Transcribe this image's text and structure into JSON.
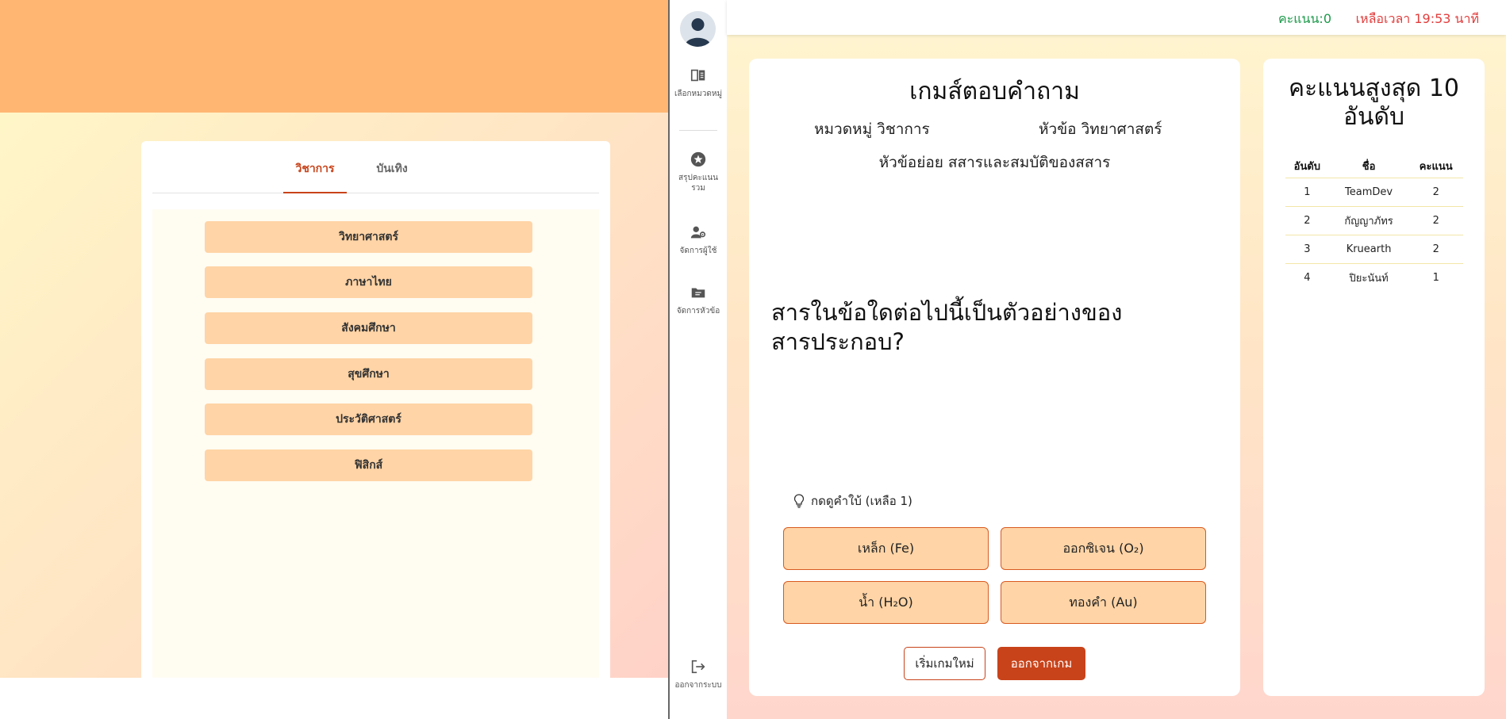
{
  "left": {
    "tabs": [
      {
        "label": "วิชาการ",
        "active": true
      },
      {
        "label": "บันเทิง",
        "active": false
      }
    ],
    "subjects": [
      "วิทยาศาสตร์",
      "ภาษาไทย",
      "สังคมศึกษา",
      "สุขศึกษา",
      "ประวัติศาสตร์",
      "ฟิสิกส์"
    ]
  },
  "sidebar": {
    "items": [
      {
        "label": "เลือกหมวดหมู่",
        "icon": "book-icon"
      },
      {
        "label": "สรุปคะแนนรวม",
        "icon": "star-icon"
      },
      {
        "label": "จัดการผู้ใช้",
        "icon": "user-gear-icon"
      },
      {
        "label": "จัดการหัวข้อ",
        "icon": "folder-icon"
      }
    ],
    "logout_label": "ออกจากระบบ"
  },
  "topbar": {
    "score": "คะแนน:0",
    "time_left": "เหลือเวลา 19:53 นาที"
  },
  "game": {
    "title": "เกมส์ตอบคำถาม",
    "category": "หมวดหมู่ วิชาการ",
    "topic": "หัวข้อ วิทยาศาสตร์",
    "subtopic": "หัวข้อย่อย สสารและสมบัติของสสาร",
    "question": "สารในข้อใดต่อไปนี้เป็นตัวอย่างของสารประกอบ?",
    "hint_label": "กดดูคำใบ้ (เหลือ 1)",
    "answers": [
      "เหล็ก (Fe)",
      "ออกซิเจน (O₂)",
      "น้ำ (H₂O)",
      "ทองคำ (Au)"
    ],
    "restart_label": "เริ่มเกมใหม่",
    "quit_label": "ออกจากเกม"
  },
  "leaderboard": {
    "title": "คะแนนสูงสุด 10 อันดับ",
    "headers": [
      "อันดับ",
      "ชื่อ",
      "คะแนน"
    ],
    "rows": [
      [
        "1",
        "TeamDev",
        "2"
      ],
      [
        "2",
        "กัญญาภัทร",
        "2"
      ],
      [
        "3",
        "Kruearth",
        "2"
      ],
      [
        "4",
        "ปิยะนันท์",
        "1"
      ]
    ]
  },
  "colors": {
    "accent": "#c8431a",
    "answer_fill": "#ffd4a6",
    "score_green": "#1c9a4a",
    "timer_red": "#e23d3d"
  }
}
